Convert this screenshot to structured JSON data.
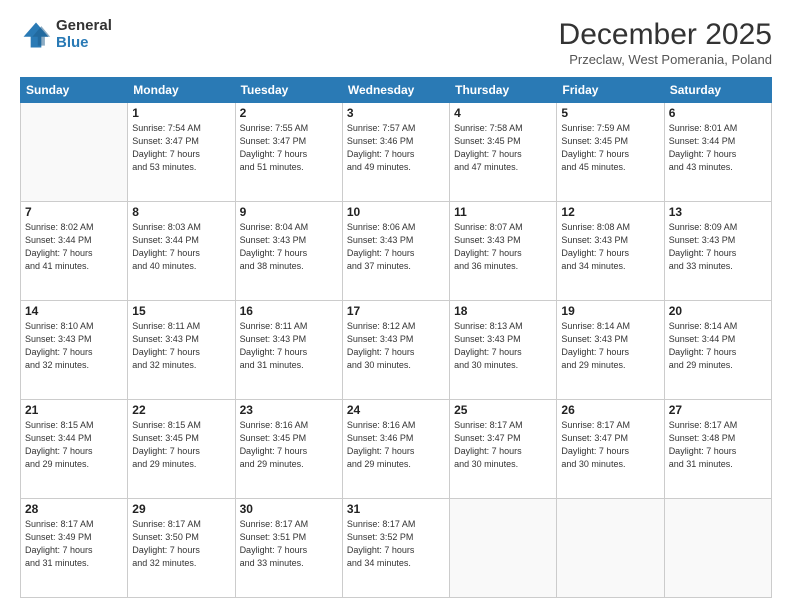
{
  "logo": {
    "general": "General",
    "blue": "Blue"
  },
  "header": {
    "month": "December 2025",
    "location": "Przeclaw, West Pomerania, Poland"
  },
  "days_of_week": [
    "Sunday",
    "Monday",
    "Tuesday",
    "Wednesday",
    "Thursday",
    "Friday",
    "Saturday"
  ],
  "weeks": [
    [
      {
        "day": "",
        "info": ""
      },
      {
        "day": "1",
        "info": "Sunrise: 7:54 AM\nSunset: 3:47 PM\nDaylight: 7 hours\nand 53 minutes."
      },
      {
        "day": "2",
        "info": "Sunrise: 7:55 AM\nSunset: 3:47 PM\nDaylight: 7 hours\nand 51 minutes."
      },
      {
        "day": "3",
        "info": "Sunrise: 7:57 AM\nSunset: 3:46 PM\nDaylight: 7 hours\nand 49 minutes."
      },
      {
        "day": "4",
        "info": "Sunrise: 7:58 AM\nSunset: 3:45 PM\nDaylight: 7 hours\nand 47 minutes."
      },
      {
        "day": "5",
        "info": "Sunrise: 7:59 AM\nSunset: 3:45 PM\nDaylight: 7 hours\nand 45 minutes."
      },
      {
        "day": "6",
        "info": "Sunrise: 8:01 AM\nSunset: 3:44 PM\nDaylight: 7 hours\nand 43 minutes."
      }
    ],
    [
      {
        "day": "7",
        "info": "Sunrise: 8:02 AM\nSunset: 3:44 PM\nDaylight: 7 hours\nand 41 minutes."
      },
      {
        "day": "8",
        "info": "Sunrise: 8:03 AM\nSunset: 3:44 PM\nDaylight: 7 hours\nand 40 minutes."
      },
      {
        "day": "9",
        "info": "Sunrise: 8:04 AM\nSunset: 3:43 PM\nDaylight: 7 hours\nand 38 minutes."
      },
      {
        "day": "10",
        "info": "Sunrise: 8:06 AM\nSunset: 3:43 PM\nDaylight: 7 hours\nand 37 minutes."
      },
      {
        "day": "11",
        "info": "Sunrise: 8:07 AM\nSunset: 3:43 PM\nDaylight: 7 hours\nand 36 minutes."
      },
      {
        "day": "12",
        "info": "Sunrise: 8:08 AM\nSunset: 3:43 PM\nDaylight: 7 hours\nand 34 minutes."
      },
      {
        "day": "13",
        "info": "Sunrise: 8:09 AM\nSunset: 3:43 PM\nDaylight: 7 hours\nand 33 minutes."
      }
    ],
    [
      {
        "day": "14",
        "info": "Sunrise: 8:10 AM\nSunset: 3:43 PM\nDaylight: 7 hours\nand 32 minutes."
      },
      {
        "day": "15",
        "info": "Sunrise: 8:11 AM\nSunset: 3:43 PM\nDaylight: 7 hours\nand 32 minutes."
      },
      {
        "day": "16",
        "info": "Sunrise: 8:11 AM\nSunset: 3:43 PM\nDaylight: 7 hours\nand 31 minutes."
      },
      {
        "day": "17",
        "info": "Sunrise: 8:12 AM\nSunset: 3:43 PM\nDaylight: 7 hours\nand 30 minutes."
      },
      {
        "day": "18",
        "info": "Sunrise: 8:13 AM\nSunset: 3:43 PM\nDaylight: 7 hours\nand 30 minutes."
      },
      {
        "day": "19",
        "info": "Sunrise: 8:14 AM\nSunset: 3:43 PM\nDaylight: 7 hours\nand 29 minutes."
      },
      {
        "day": "20",
        "info": "Sunrise: 8:14 AM\nSunset: 3:44 PM\nDaylight: 7 hours\nand 29 minutes."
      }
    ],
    [
      {
        "day": "21",
        "info": "Sunrise: 8:15 AM\nSunset: 3:44 PM\nDaylight: 7 hours\nand 29 minutes."
      },
      {
        "day": "22",
        "info": "Sunrise: 8:15 AM\nSunset: 3:45 PM\nDaylight: 7 hours\nand 29 minutes."
      },
      {
        "day": "23",
        "info": "Sunrise: 8:16 AM\nSunset: 3:45 PM\nDaylight: 7 hours\nand 29 minutes."
      },
      {
        "day": "24",
        "info": "Sunrise: 8:16 AM\nSunset: 3:46 PM\nDaylight: 7 hours\nand 29 minutes."
      },
      {
        "day": "25",
        "info": "Sunrise: 8:17 AM\nSunset: 3:47 PM\nDaylight: 7 hours\nand 30 minutes."
      },
      {
        "day": "26",
        "info": "Sunrise: 8:17 AM\nSunset: 3:47 PM\nDaylight: 7 hours\nand 30 minutes."
      },
      {
        "day": "27",
        "info": "Sunrise: 8:17 AM\nSunset: 3:48 PM\nDaylight: 7 hours\nand 31 minutes."
      }
    ],
    [
      {
        "day": "28",
        "info": "Sunrise: 8:17 AM\nSunset: 3:49 PM\nDaylight: 7 hours\nand 31 minutes."
      },
      {
        "day": "29",
        "info": "Sunrise: 8:17 AM\nSunset: 3:50 PM\nDaylight: 7 hours\nand 32 minutes."
      },
      {
        "day": "30",
        "info": "Sunrise: 8:17 AM\nSunset: 3:51 PM\nDaylight: 7 hours\nand 33 minutes."
      },
      {
        "day": "31",
        "info": "Sunrise: 8:17 AM\nSunset: 3:52 PM\nDaylight: 7 hours\nand 34 minutes."
      },
      {
        "day": "",
        "info": ""
      },
      {
        "day": "",
        "info": ""
      },
      {
        "day": "",
        "info": ""
      }
    ]
  ]
}
